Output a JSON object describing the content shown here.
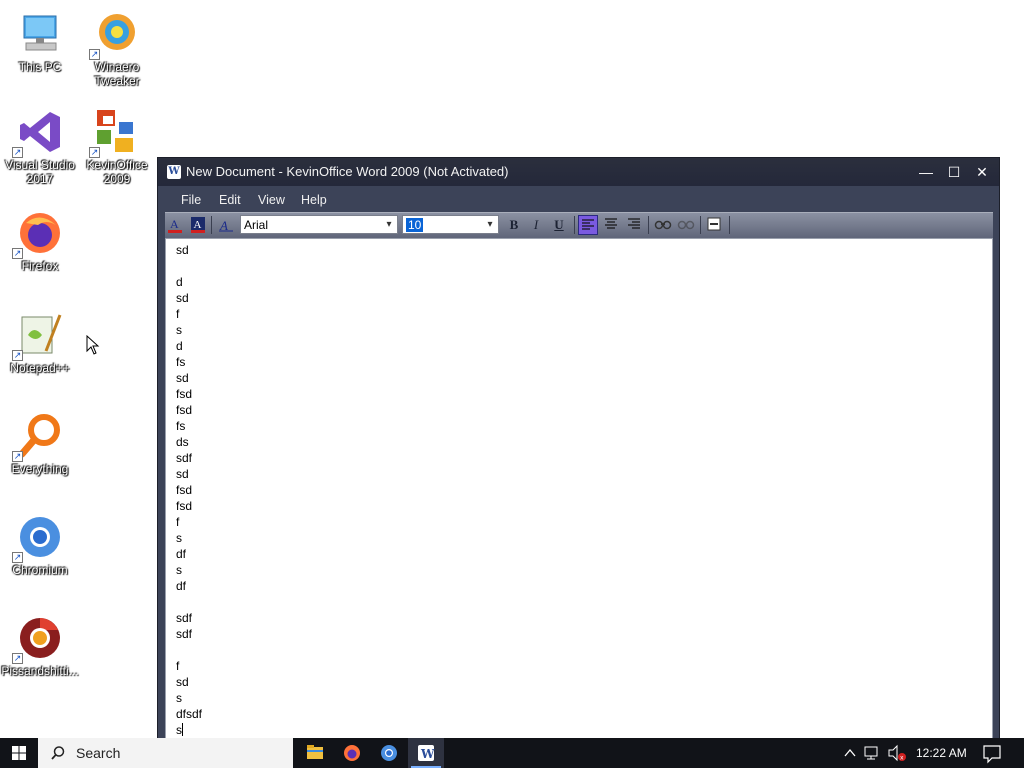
{
  "desktop": {
    "icons": [
      {
        "label": "This PC",
        "icon": "this-pc-icon"
      },
      {
        "label": "Winaero Tweaker",
        "icon": "winaero-tweaker-icon"
      },
      {
        "label": "Visual Studio 2017",
        "icon": "visual-studio-icon"
      },
      {
        "label": "KevinOffice 2009",
        "icon": "kevinoffice-icon"
      },
      {
        "label": "Firefox",
        "icon": "firefox-icon"
      },
      {
        "label": "Notepad++",
        "icon": "notepadpp-icon"
      },
      {
        "label": "Everything",
        "icon": "everything-icon"
      },
      {
        "label": "Chromium",
        "icon": "chromium-icon"
      },
      {
        "label": "Pissandshitti...",
        "icon": "chrome-variant-icon"
      }
    ]
  },
  "window": {
    "title": "New Document - KevinOffice Word 2009 (Not Activated)",
    "app_icon_letter": "W",
    "controls": {
      "minimize": "—",
      "maximize": "☐",
      "close": "✕"
    },
    "menu": [
      "File",
      "Edit",
      "View",
      "Help"
    ],
    "toolbar": {
      "font_name": "Arial",
      "font_size": "10",
      "bold": "B",
      "italic": "I",
      "underline": "U",
      "align": "left"
    },
    "document_lines": [
      "sd",
      "",
      "d",
      "sd",
      "f",
      "s",
      "d",
      "fs",
      "sd",
      "fsd",
      "fsd",
      "fs",
      "ds",
      "sdf",
      "sd",
      "fsd",
      "fsd",
      "f",
      "s",
      "df",
      "s",
      "df",
      "",
      "sdf",
      "sdf",
      "",
      "f",
      "sd",
      "s",
      "dfsdf",
      "s"
    ]
  },
  "taskbar": {
    "search_label": "Search",
    "time": "12:22 AM",
    "pinned": [
      "file-explorer-icon",
      "firefox-icon",
      "chromium-icon",
      "kevinoffice-word-icon"
    ]
  },
  "colors": {
    "window_frame": "#3c4358",
    "titlebar": "#262a3a",
    "taskbar": "#111318",
    "selection": "#0a64d6"
  }
}
